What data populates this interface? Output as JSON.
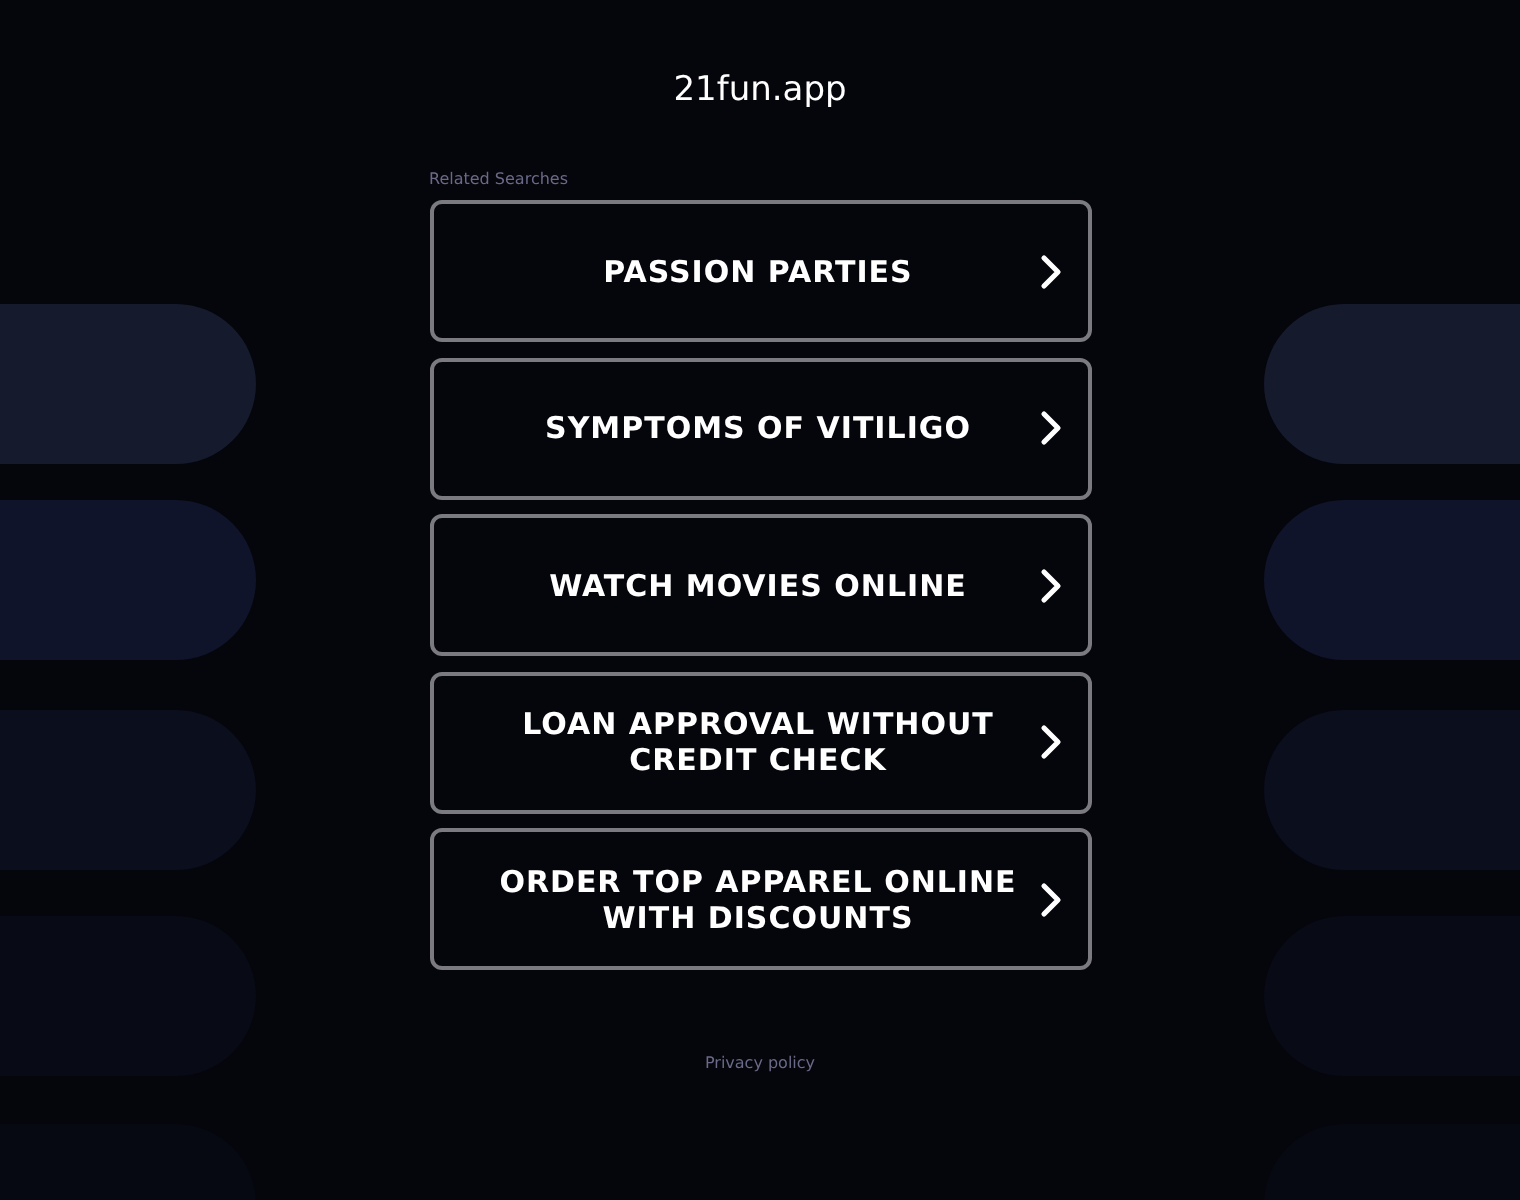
{
  "site_title": "21fun.app",
  "related_heading": "Related Searches",
  "links": [
    {
      "label": "PASSION PARTIES"
    },
    {
      "label": "SYMPTOMS OF VITILIGO"
    },
    {
      "label": "WATCH MOVIES ONLINE"
    },
    {
      "label": "LOAN APPROVAL WITHOUT CREDIT CHECK"
    },
    {
      "label": "ORDER TOP APPAREL ONLINE WITH DISCOUNTS"
    }
  ],
  "footer_link": "Privacy policy"
}
